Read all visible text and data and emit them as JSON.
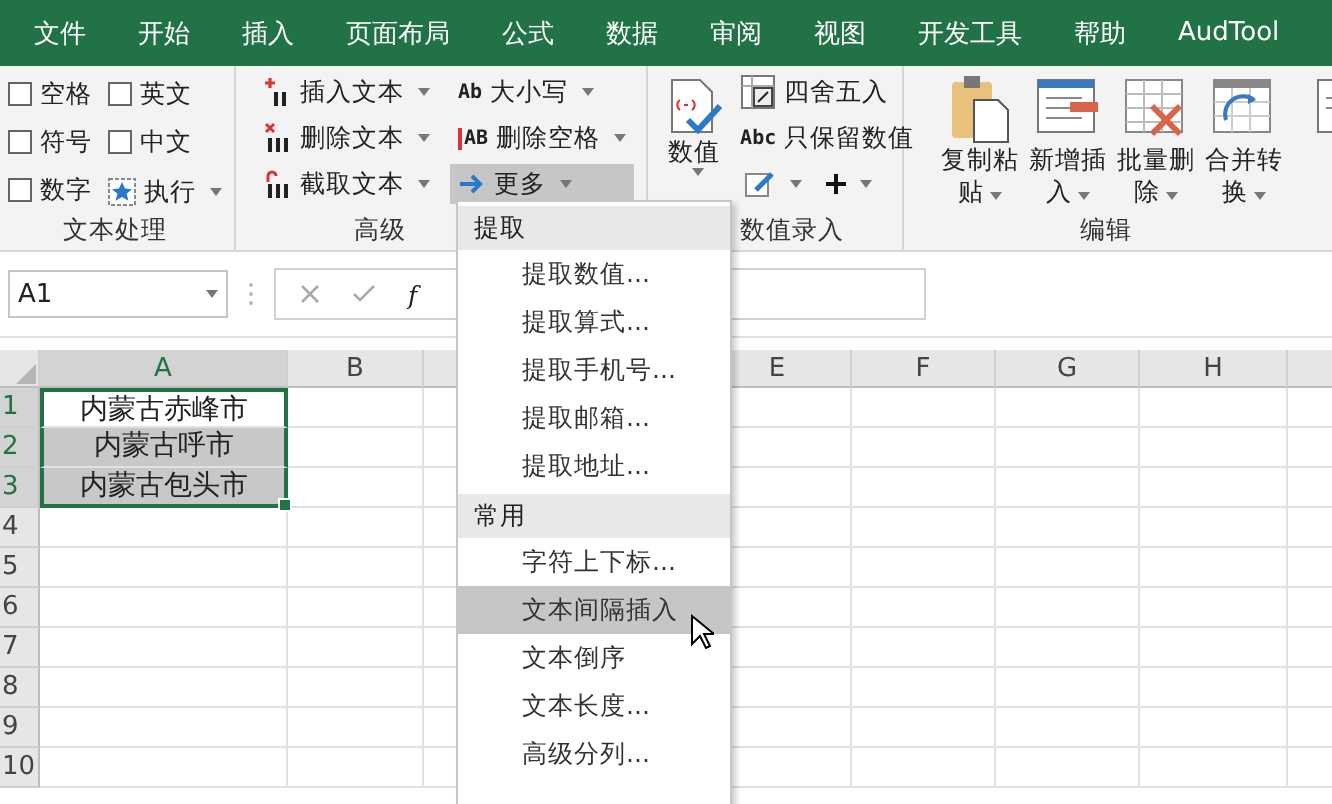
{
  "menu_tabs": [
    {
      "label": "文件"
    },
    {
      "label": "开始"
    },
    {
      "label": "插入"
    },
    {
      "label": "页面布局"
    },
    {
      "label": "公式"
    },
    {
      "label": "数据"
    },
    {
      "label": "审阅"
    },
    {
      "label": "视图"
    },
    {
      "label": "开发工具"
    },
    {
      "label": "帮助"
    },
    {
      "label": "AudTool"
    }
  ],
  "ribbon": {
    "groups": [
      {
        "kind": "checks",
        "label": "文本处理",
        "items": [
          {
            "kind": "checkbox",
            "label": "空格",
            "checked": false
          },
          {
            "kind": "checkbox",
            "label": "英文",
            "checked": false
          },
          {
            "kind": "checkbox",
            "label": "符号",
            "checked": false
          },
          {
            "kind": "checkbox",
            "label": "中文",
            "checked": false
          },
          {
            "kind": "checkbox",
            "label": "数字",
            "checked": false
          },
          {
            "kind": "action",
            "label": "执行"
          }
        ]
      },
      {
        "kind": "small",
        "label": "高级",
        "columns": [
          [
            {
              "label": "插入文本",
              "pressed": false
            },
            {
              "label": "删除文本",
              "pressed": false
            },
            {
              "label": "截取文本",
              "pressed": false
            }
          ],
          [
            {
              "badge": "Ab",
              "label": "大小写",
              "pressed": false
            },
            {
              "badge": "AB",
              "label": "删除空格",
              "pressed": false
            },
            {
              "label": "更多",
              "pressed": true
            }
          ]
        ]
      },
      {
        "kind": "numbers",
        "label": "数值录入",
        "big": {
          "label": "数值"
        },
        "items": [
          {
            "label": "四舍五入"
          },
          {
            "badge": "Abc",
            "label": "只保留数值"
          }
        ]
      },
      {
        "kind": "large",
        "label": "编辑",
        "items": [
          {
            "lines": [
              "复制粘",
              "贴"
            ]
          },
          {
            "lines": [
              "新增插",
              "入"
            ]
          },
          {
            "lines": [
              "批量删",
              "除"
            ]
          },
          {
            "lines": [
              "合并转",
              "换"
            ]
          }
        ]
      }
    ]
  },
  "formula_bar": {
    "name_box": "A1",
    "fx": "f"
  },
  "sheet": {
    "columns": [
      {
        "label": "A"
      },
      {
        "label": "B"
      },
      {},
      {
        "label": "E"
      },
      {
        "label": "F"
      },
      {
        "label": "G"
      },
      {
        "label": "H"
      },
      {}
    ],
    "rows": [
      {
        "number": "1",
        "cell": "内蒙古赤峰市",
        "selected": true,
        "shaded": false
      },
      {
        "number": "2",
        "cell": "内蒙古呼市",
        "selected": true,
        "shaded": true
      },
      {
        "number": "3",
        "cell": "内蒙古包头市",
        "selected": true,
        "shaded": true
      },
      {
        "number": "4",
        "selected": false,
        "shaded": false
      },
      {
        "number": "5",
        "selected": false,
        "shaded": false
      },
      {
        "number": "6",
        "selected": false,
        "shaded": false
      },
      {
        "number": "7",
        "selected": false,
        "shaded": false
      },
      {
        "number": "8",
        "selected": false,
        "shaded": false
      },
      {
        "number": "9",
        "selected": false,
        "shaded": false
      },
      {
        "number": "10",
        "selected": false,
        "shaded": false
      }
    ]
  },
  "dropdown_menu": {
    "sections": [
      {
        "header": "提取",
        "items": [
          {
            "label": "提取数值...",
            "selected": false
          },
          {
            "label": "提取算式...",
            "selected": false
          },
          {
            "label": "提取手机号...",
            "selected": false
          },
          {
            "label": "提取邮箱...",
            "selected": false
          },
          {
            "label": "提取地址...",
            "selected": false
          }
        ]
      },
      {
        "header": "常用",
        "items": [
          {
            "label": "字符上下标...",
            "selected": false
          },
          {
            "label": "文本间隔插入",
            "selected": true
          },
          {
            "label": "文本倒序",
            "selected": false
          },
          {
            "label": "文本长度...",
            "selected": false
          },
          {
            "label": "高级分列...",
            "selected": false
          }
        ]
      }
    ]
  }
}
